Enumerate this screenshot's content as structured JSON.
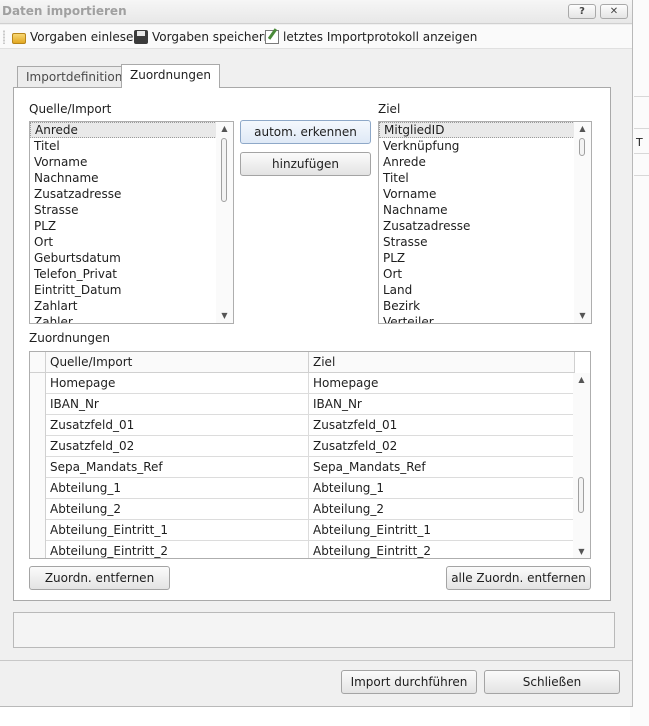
{
  "window": {
    "title": "Daten importieren",
    "help_button": "?",
    "close_button": "✕"
  },
  "toolbar": {
    "load_label": "Vorgaben einlesen",
    "save_label": "Vorgaben speichern",
    "protocol_label": "letztes Importprotokoll anzeigen"
  },
  "tabs": [
    {
      "label": "Importdefinition",
      "active": false
    },
    {
      "label": "Zuordnungen",
      "active": true
    }
  ],
  "source": {
    "label": "Quelle/Import",
    "items": [
      "Anrede",
      "Titel",
      "Vorname",
      "Nachname",
      "Zusatzadresse",
      "Strasse",
      "PLZ",
      "Ort",
      "Geburtsdatum",
      "Telefon_Privat",
      "Eintritt_Datum",
      "Zahlart",
      "Zahler"
    ],
    "selected": "Anrede"
  },
  "target": {
    "label": "Ziel",
    "items": [
      "MitgliedID",
      "Verknüpfung",
      "Anrede",
      "Titel",
      "Vorname",
      "Nachname",
      "Zusatzadresse",
      "Strasse",
      "PLZ",
      "Ort",
      "Land",
      "Bezirk",
      "Verteiler"
    ],
    "selected": "MitgliedID"
  },
  "buttons": {
    "auto_detect": "autom. erkennen",
    "add": "hinzufügen",
    "remove_mapping": "Zuordn. entfernen",
    "remove_all_mappings": "alle Zuordn. entfernen",
    "import_run": "Import durchführen",
    "close": "Schließen"
  },
  "mappings": {
    "label": "Zuordnungen",
    "columns": [
      "Quelle/Import",
      "Ziel"
    ],
    "rows": [
      [
        "Homepage",
        "Homepage"
      ],
      [
        "IBAN_Nr",
        "IBAN_Nr"
      ],
      [
        "Zusatzfeld_01",
        "Zusatzfeld_01"
      ],
      [
        "Zusatzfeld_02",
        "Zusatzfeld_02"
      ],
      [
        "Sepa_Mandats_Ref",
        "Sepa_Mandats_Ref"
      ],
      [
        "Abteilung_1",
        "Abteilung_1"
      ],
      [
        "Abteilung_2",
        "Abteilung_2"
      ],
      [
        "Abteilung_Eintritt_1",
        "Abteilung_Eintritt_1"
      ],
      [
        "Abteilung_Eintritt_2",
        "Abteilung_Eintritt_2"
      ]
    ]
  },
  "background_app": {
    "cell_text": "T"
  }
}
